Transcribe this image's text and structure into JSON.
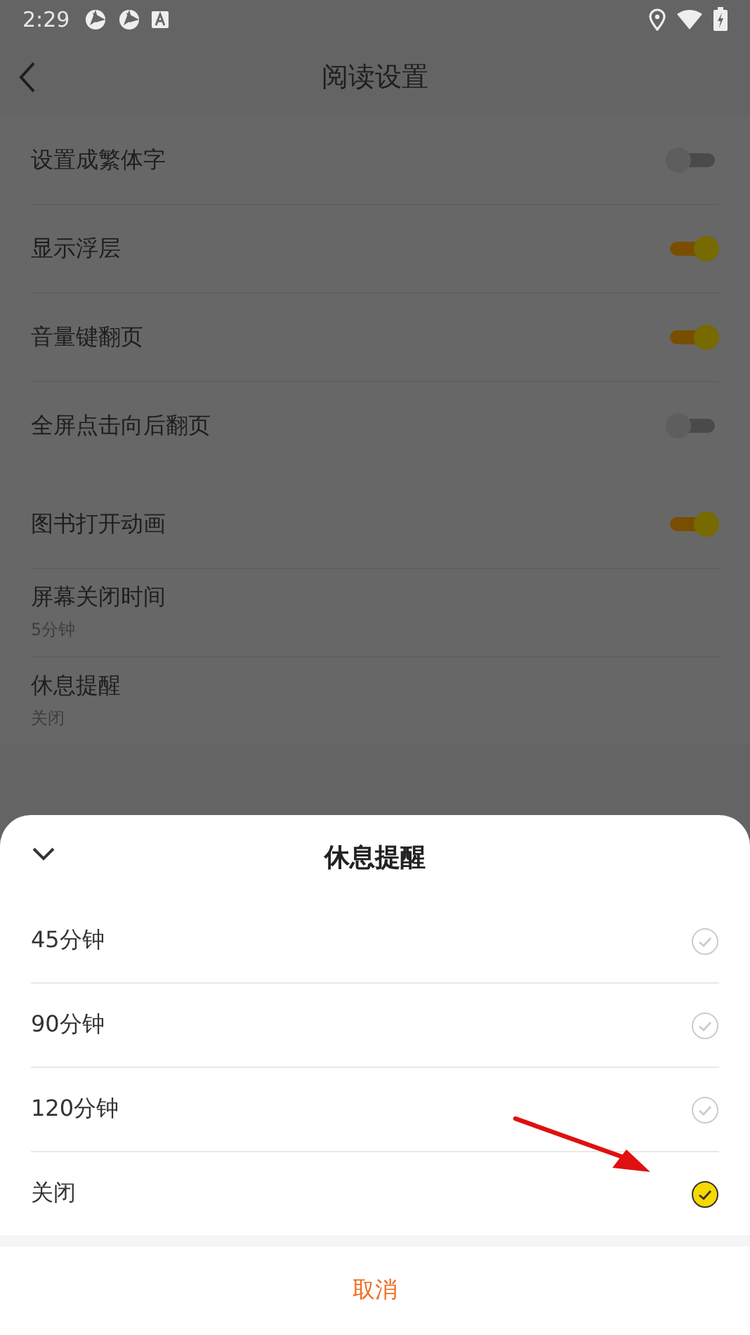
{
  "status_bar": {
    "time": "2:29"
  },
  "header": {
    "title": "阅读设置"
  },
  "groups": [
    {
      "items": [
        {
          "kind": "toggle",
          "label": "设置成繁体字",
          "on": false
        },
        {
          "kind": "toggle",
          "label": "显示浮层",
          "on": true
        },
        {
          "kind": "toggle",
          "label": "音量键翻页",
          "on": true
        },
        {
          "kind": "toggle",
          "label": "全屏点击向后翻页",
          "on": false
        }
      ]
    },
    {
      "items": [
        {
          "kind": "toggle",
          "label": "图书打开动画",
          "on": true
        },
        {
          "kind": "value",
          "label": "屏幕关闭时间",
          "value": "5分钟"
        },
        {
          "kind": "value",
          "label": "休息提醒",
          "value": "关闭"
        }
      ]
    }
  ],
  "sheet": {
    "title": "休息提醒",
    "options": [
      {
        "label": "45分钟",
        "selected": false
      },
      {
        "label": "90分钟",
        "selected": false
      },
      {
        "label": "120分钟",
        "selected": false
      },
      {
        "label": "关闭",
        "selected": true
      }
    ],
    "cancel": "取消"
  }
}
